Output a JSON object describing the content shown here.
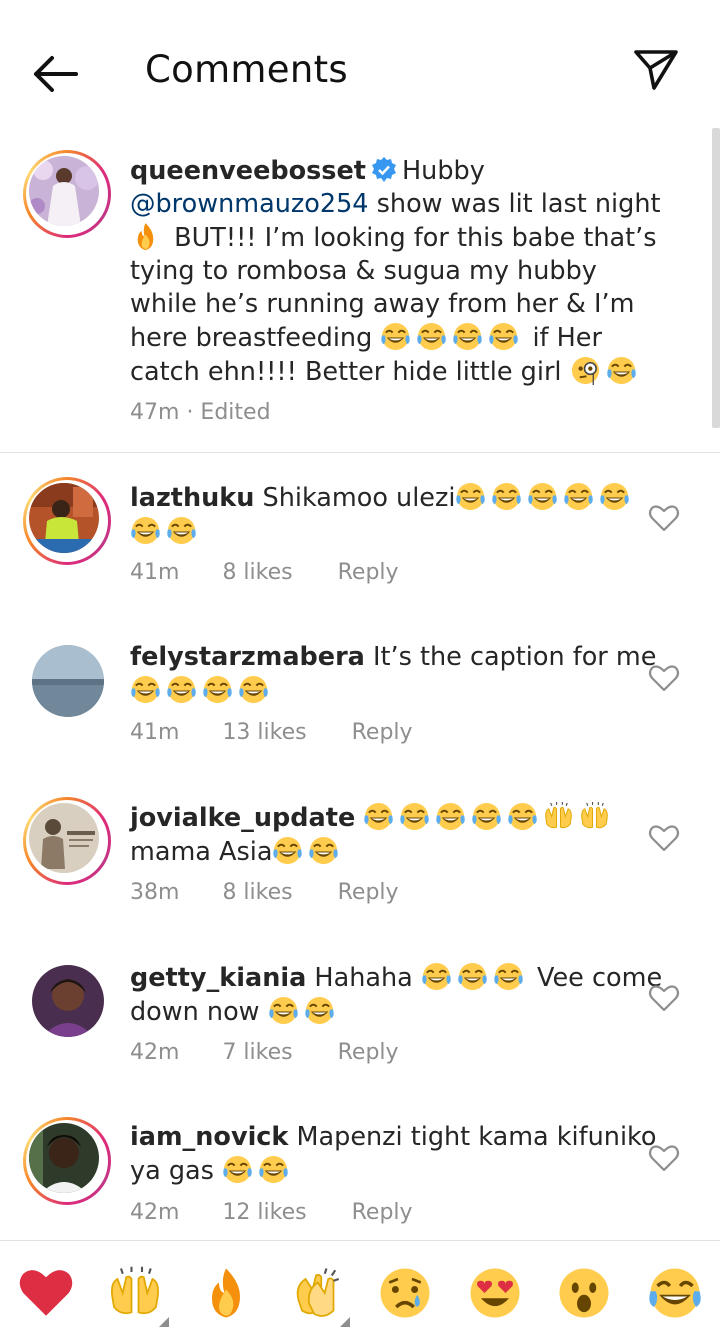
{
  "header": {
    "title": "Comments"
  },
  "caption": {
    "username": "queenveebosset",
    "text_1": "Hubby",
    "mention": "@brownmauzo254",
    "text_2": "show was lit last night",
    "text_3": "BUT!!! I’m looking for this babe that’s tying to rombosa & sugua my hubby while he’s running away from her & I’m here breastfeeding",
    "text_4": "if Her catch ehn!!!! Better hide little girl",
    "time": "47m",
    "edited": "· Edited"
  },
  "comments": [
    {
      "username": "lazthuku",
      "text": "Shikamoo  ulezi",
      "time": "41m",
      "likes": "8 likes",
      "reply": "Reply"
    },
    {
      "username": "felystarzmabera",
      "text": "It’s the caption for me",
      "time": "41m",
      "likes": "13 likes",
      "reply": "Reply"
    },
    {
      "username": "jovialke_update",
      "text": "mama Asia",
      "time": "38m",
      "likes": "8 likes",
      "reply": "Reply"
    },
    {
      "username": "getty_kiania",
      "text": "Hahaha",
      "text_2": "Vee come down now",
      "time": "42m",
      "likes": "7 likes",
      "reply": "Reply"
    },
    {
      "username": "iam_novick",
      "text": "Mapenzi tight kama kifuniko ya gas",
      "time": "42m",
      "likes": "12 likes",
      "reply": "Reply"
    }
  ],
  "reactions": [
    "heart",
    "raising-hands",
    "fire",
    "clapping-hands",
    "crying-face",
    "heart-eyes-face",
    "surprised-face",
    "tears-of-joy-face"
  ],
  "colors": {
    "accent_blue": "#3897f0",
    "mention": "#00376b",
    "meta_gray": "#8e8e8e",
    "like_red": "#ed4956"
  }
}
